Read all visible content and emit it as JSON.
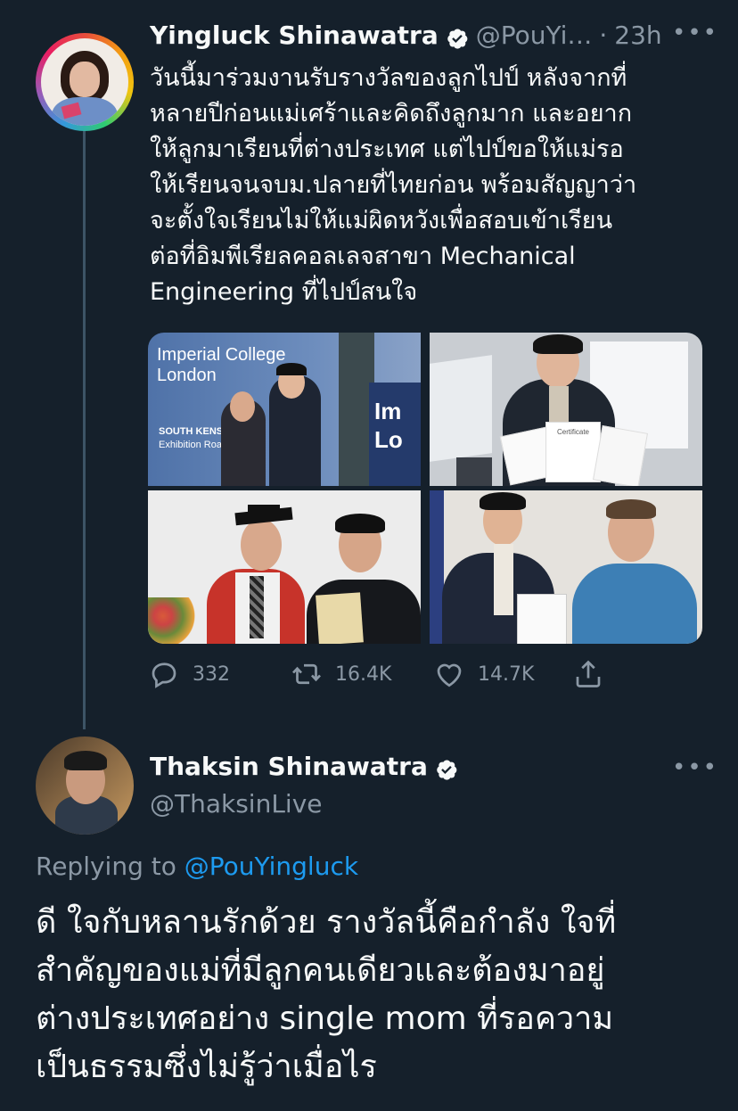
{
  "tweet1": {
    "author_name": "Yingluck Shinawatra",
    "handle": "@PouYi…",
    "separator": "·",
    "time": "23h",
    "more_label": "•••",
    "text": "วันนี้มาร่วมงานรับรางวัลของลูกไปป์ หลังจากที่\nหลายปีก่อนแม่เศร้าและคิดถึงลูกมาก และอยาก\nให้ลูกมาเรียนที่ต่างประเทศ แต่ไปป์ขอให้แม่รอ\nให้เรียนจนจบม.ปลายที่ไทยก่อน พร้อมสัญญาว่า\nจะตั้งใจเรียนไม่ให้แม่ผิดหวังเพื่อสอบเข้าเรียน\nต่อที่อิมพีเรียลคอลเลจสาขา Mechanical\nEngineering ที่ไปป์สนใจ",
    "photo1_sign_line1": "Imperial College",
    "photo1_sign_line2": "London",
    "photo1_small_line1": "SOUTH KENSINGTO",
    "photo1_small_line2": "Exhibition Road",
    "photo1_sign_right": "Im",
    "photo1_sign_right2": "Lo",
    "certificate_label": "Certificate",
    "stats": {
      "replies": "332",
      "retweets": "16.4K",
      "likes": "14.7K"
    },
    "icons": {
      "reply": "reply-icon",
      "retweet": "retweet-icon",
      "like": "heart-icon",
      "share": "share-icon",
      "verified": "verified-badge-icon"
    }
  },
  "tweet2": {
    "author_name": "Thaksin Shinawatra",
    "handle": "@ThaksinLive",
    "more_label": "•••",
    "replying_prefix": "Replying to",
    "replying_to": "@PouYingluck",
    "text": "ดี ใจกับหลานรักด้วย รางวัลนี้คือกำลัง ใจที่\nสำคัญของแม่ที่มีลูกคนเดียวและต้องมาอยู่\nต่างประเทศอย่าง single mom ที่รอความ\nเป็นธรรมซึ่งไม่รู้ว่าเมื่อไร"
  },
  "colors": {
    "background": "#15202b",
    "text": "#f7f9f9",
    "secondary": "#8b98a5",
    "accent": "#1d9bf0",
    "thread_line": "#3d5466"
  }
}
